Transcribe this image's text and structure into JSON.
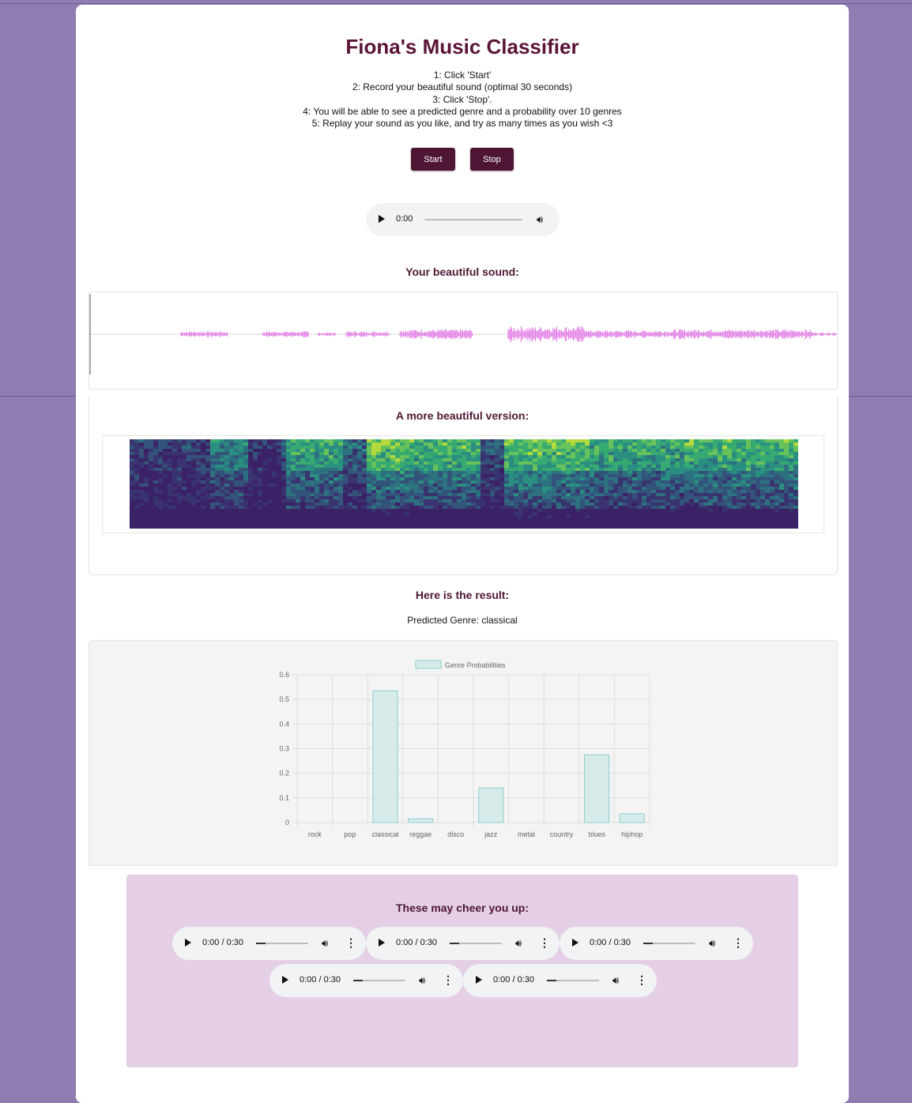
{
  "app": {
    "title": "Fiona's Music Classifier",
    "instructions": [
      "1: Click 'Start'",
      "2: Record your beautiful sound (optimal 30 seconds)",
      "3: Click 'Stop'.",
      "4: You will be able to see a predicted genre and a probability over 10 genres",
      "5: Replay your sound as you like, and try as many times as you wish <3"
    ],
    "start_label": "Start",
    "stop_label": "Stop"
  },
  "recorder_player": {
    "time": "0:00",
    "icon_play": "play-icon",
    "icon_volume": "volume-icon"
  },
  "waveform": {
    "heading": "Your beautiful sound:",
    "color": "#e27fe6"
  },
  "spectrogram": {
    "heading": "A more beautiful version:"
  },
  "result": {
    "heading": "Here is the result:",
    "predicted_text": "Predicted Genre: classical"
  },
  "chart_data": {
    "type": "bar",
    "categories": [
      "rock",
      "pop",
      "classical",
      "reggae",
      "disco",
      "jazz",
      "metal",
      "country",
      "blues",
      "hiphop"
    ],
    "series": [
      {
        "name": "Genre Probabilities",
        "values": [
          0,
          0,
          0.535,
          0.015,
          0,
          0.14,
          0,
          0,
          0.275,
          0.035
        ]
      }
    ],
    "ylim": [
      0,
      0.6
    ],
    "yticks": [
      "0",
      "0.1",
      "0.2",
      "0.3",
      "0.4",
      "0.5",
      "0.6"
    ],
    "grid": true,
    "legend": "top-center",
    "bar_fill": "#d7ebea",
    "bar_stroke": "#8ccfd0"
  },
  "cheer": {
    "heading": "These may cheer you up:",
    "players": [
      {
        "time": "0:00 / 0:30"
      },
      {
        "time": "0:00 / 0:30"
      },
      {
        "time": "0:00 / 0:30"
      },
      {
        "time": "0:00 / 0:30"
      },
      {
        "time": "0:00 / 0:30"
      }
    ]
  },
  "colors": {
    "page_background": "#8f7db2",
    "accent": "#4e1634",
    "title": "#5a1438",
    "cheer_background": "#e4cfe6"
  }
}
